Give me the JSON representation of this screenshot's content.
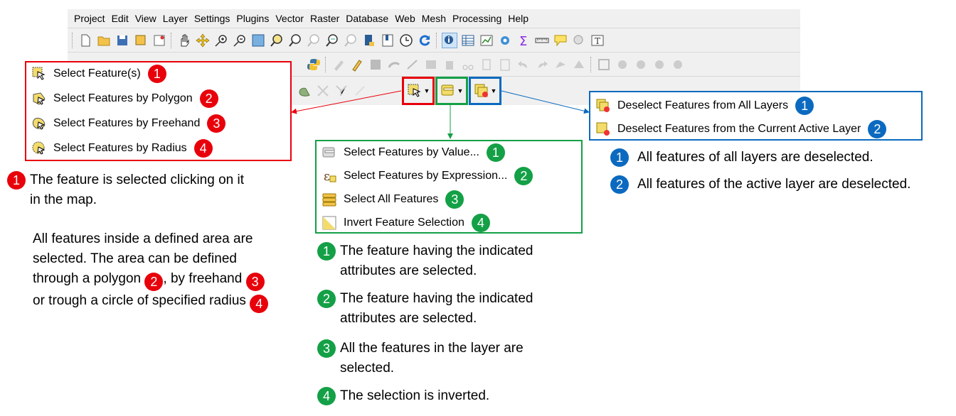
{
  "menu": [
    "Project",
    "Edit",
    "View",
    "Layer",
    "Settings",
    "Plugins",
    "Vector",
    "Raster",
    "Database",
    "Web",
    "Mesh",
    "Processing",
    "Help"
  ],
  "select_features_menu": {
    "items": [
      {
        "label": "Select Feature(s)",
        "badge": "1"
      },
      {
        "label": "Select Features by Polygon",
        "badge": "2"
      },
      {
        "label": "Select Features by Freehand",
        "badge": "3"
      },
      {
        "label": "Select Features by Radius",
        "badge": "4"
      }
    ],
    "color": "#e8000b"
  },
  "select_by_menu": {
    "items": [
      {
        "label": "Select Features by Value...",
        "badge": "1"
      },
      {
        "label": "Select Features by Expression...",
        "badge": "2"
      },
      {
        "label": "Select All Features",
        "badge": "3"
      },
      {
        "label": "Invert Feature Selection",
        "badge": "4"
      }
    ],
    "color": "#14a046"
  },
  "deselect_menu": {
    "items": [
      {
        "label": "Deselect Features from All Layers",
        "badge": "1"
      },
      {
        "label": "Deselect Features from the Current Active Layer",
        "badge": "2"
      }
    ],
    "color": "#0b6abf"
  },
  "left_notes": {
    "n1_badge": "1",
    "n1_line1": "The feature is selected clicking on it",
    "n1_line2": "in the map.",
    "p_line1": "All features inside a defined area are",
    "p_line2": "selected. The area can be defined",
    "p_line3a": "through a polygon ",
    "p_badge2": "2",
    "p_line3b": ", by freehand ",
    "p_badge3": "3",
    "p_line4": "or trough a circle of specified radius ",
    "p_badge4": "4"
  },
  "middle_notes": [
    {
      "badge": "1",
      "line1": "The feature having the indicated",
      "line2": "attributes are selected."
    },
    {
      "badge": "2",
      "line1": "The feature having the indicated",
      "line2": "attributes are selected."
    },
    {
      "badge": "3",
      "line1": "All the features in the layer are",
      "line2": "selected."
    },
    {
      "badge": "4",
      "line1": "The selection is inverted.",
      "line2": ""
    }
  ],
  "right_notes": [
    {
      "badge": "1",
      "text": "All features of all layers are deselected."
    },
    {
      "badge": "2",
      "text": "All features of the active layer are deselected."
    }
  ],
  "colors": {
    "red": "#e8000b",
    "green": "#14a046",
    "blue": "#0b6abf",
    "toolbar_bg": "#f0f0f0"
  }
}
